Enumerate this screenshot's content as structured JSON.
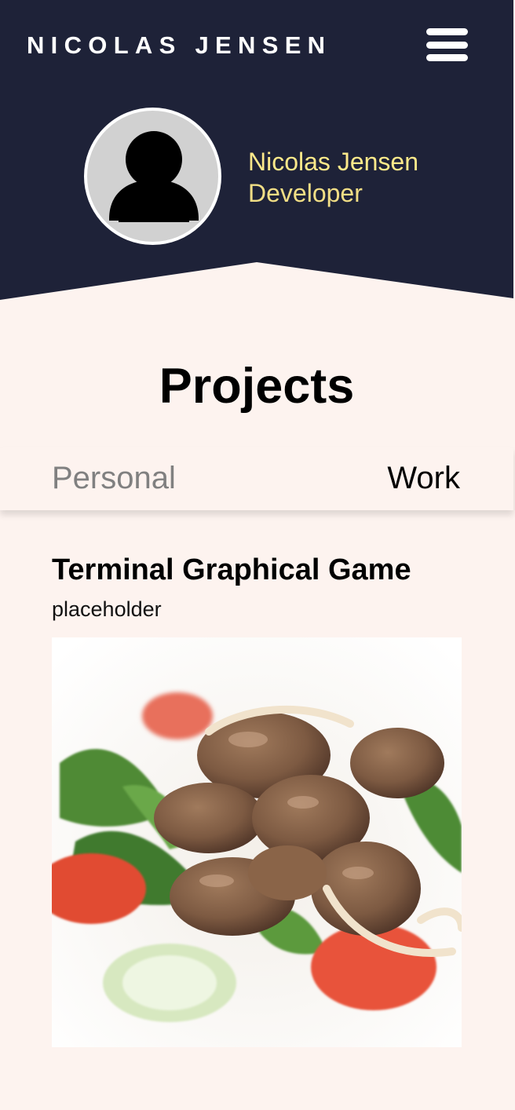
{
  "navbar": {
    "brand": "NICOLAS JENSEN",
    "menu_icon": "hamburger-icon"
  },
  "profile": {
    "name": "Nicolas Jensen",
    "role": "Developer",
    "avatar_icon": "user-avatar-icon"
  },
  "projects": {
    "title": "Projects",
    "tabs": [
      {
        "label": "Personal",
        "active": false
      },
      {
        "label": "Work",
        "active": true
      }
    ],
    "items": [
      {
        "title": "Terminal Graphical Game",
        "description": "placeholder",
        "image": "steak-salad-photo"
      }
    ]
  },
  "colors": {
    "navy": "#1e2238",
    "accent": "#fde98a",
    "background": "#fdf3ef"
  }
}
